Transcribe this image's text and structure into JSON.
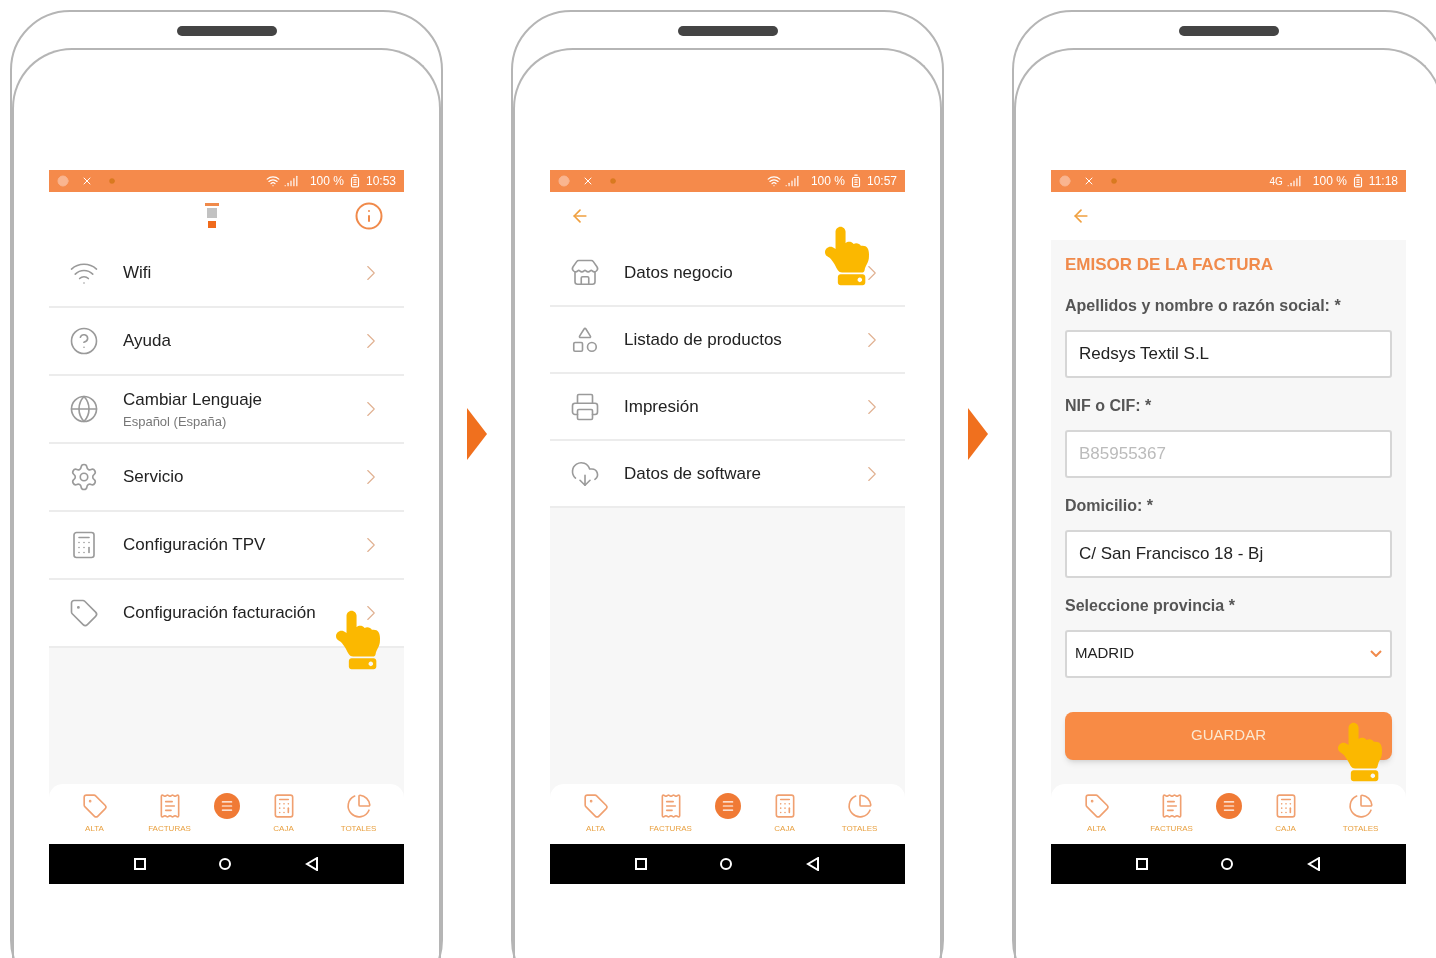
{
  "screens": [
    {
      "kind": "menu",
      "status_bar": {
        "battery": "100 %",
        "time": "10:53"
      },
      "logo": true,
      "info_button": true,
      "items": [
        {
          "title": "Wifi",
          "tapped": false
        },
        {
          "title": "Ayuda",
          "tapped": false
        },
        {
          "title": "Cambiar Lenguaje",
          "subtitle": "Español (España)",
          "tapped": false
        },
        {
          "title": "Servicio",
          "tapped": false
        },
        {
          "title": "Configuración TPV",
          "tapped": false
        },
        {
          "title": "Configuración facturación",
          "tapped": true
        }
      ],
      "nav": [
        "ALTA",
        "FACTURAS",
        "CAJA",
        "TOTALES"
      ]
    },
    {
      "kind": "menu",
      "status_bar": {
        "battery": "100 %",
        "time": "10:57"
      },
      "back_button": true,
      "items": [
        {
          "title": "Datos negocio",
          "tapped": true
        },
        {
          "title": "Listado de productos",
          "tapped": false
        },
        {
          "title": "Impresión",
          "tapped": false
        },
        {
          "title": "Datos de software",
          "tapped": false
        }
      ],
      "nav": [
        "ALTA",
        "FACTURAS",
        "CAJA",
        "TOTALES"
      ]
    },
    {
      "kind": "form",
      "status_bar": {
        "network": "4G",
        "battery": "100 %",
        "time": "11:18"
      },
      "back_button": true,
      "title": "EMISOR DE LA FACTURA",
      "fields": [
        {
          "kind": "text",
          "label": "Apellidos y nombre o razón social: *",
          "value": "Redsys Textil S.L"
        },
        {
          "kind": "text",
          "label": "NIF o CIF: *",
          "placeholder": "B85955367"
        },
        {
          "kind": "text",
          "label": "Domicilio: *",
          "value": "C/ San Francisco 18 - Bj"
        },
        {
          "kind": "select",
          "label": "Seleccione provincia *",
          "value": "MADRID"
        }
      ],
      "button": {
        "label": "GUARDAR",
        "tapped": true
      },
      "nav": [
        "ALTA",
        "FACTURAS",
        "CAJA",
        "TOTALES"
      ]
    }
  ]
}
